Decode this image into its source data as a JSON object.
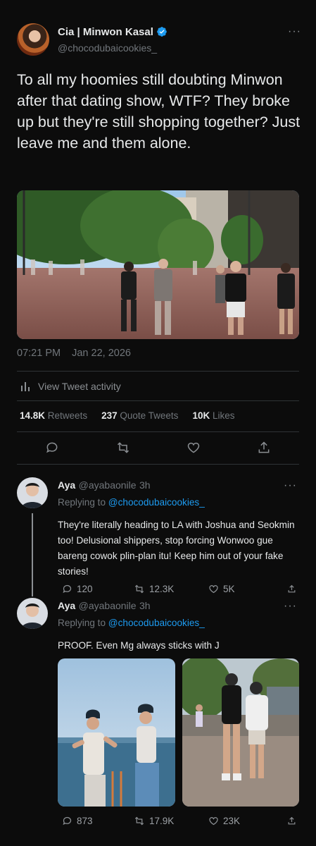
{
  "tweet": {
    "display_name": "Cia | Minwon Kasal",
    "handle": "@chocodubaicookies_",
    "more_label": "···",
    "text": "To all my hoomies still doubting Minwon after that dating show, WTF? They broke up but they're still shopping together? Just leave me and them alone.",
    "time": "07:21 PM",
    "date": "Jan 22, 2026",
    "activity_label": "View Tweet activity",
    "retweets_count": "14.8K",
    "retweets_label": "Retweets",
    "quotes_count": "237",
    "quotes_label": "Quote Tweets",
    "likes_count": "10K",
    "likes_label": "Likes"
  },
  "replies": [
    {
      "name": "Aya",
      "handle": "@ayabaonile",
      "age": "3h",
      "replying_to_label": "Replying to",
      "replying_to_handle": "@chocodubaicookies_",
      "text": "They're literally heading to LA with Joshua and Seokmin too! Delusional shippers, stop forcing Wonwoo gue bareng cowok plin-plan itu! Keep him out of your fake stories!",
      "replies": "120",
      "retweets": "12.3K",
      "likes": "5K",
      "more_label": "···"
    },
    {
      "name": "Aya",
      "handle": "@ayabaonile",
      "age": "3h",
      "replying_to_label": "Replying to",
      "replying_to_handle": "@chocodubaicookies_",
      "text": "PROOF. Even Mg always sticks with J",
      "replies": "873",
      "retweets": "17.9K",
      "likes": "23K",
      "more_label": "···"
    }
  ],
  "colors": {
    "background": "#0c0c0c",
    "text": "#e7e9ea",
    "muted": "#71767b",
    "accent": "#1d9bf0"
  },
  "icons": [
    "verified-badge-icon",
    "more-icon",
    "activity-bars-icon",
    "reply-icon",
    "retweet-icon",
    "like-icon",
    "share-icon"
  ]
}
